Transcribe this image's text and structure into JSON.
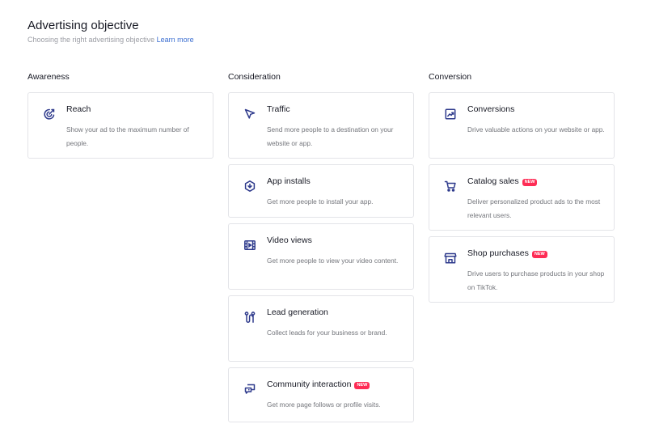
{
  "header": {
    "title": "Advertising objective",
    "subtitle": "Choosing the right advertising objective",
    "learn_more": "Learn more"
  },
  "colors": {
    "icon": "#2e3a8c",
    "badge": "#fe2c55",
    "link": "#3c6fd1"
  },
  "columns": [
    {
      "label": "Awareness",
      "items": [
        {
          "name": "Reach",
          "icon": "reach-icon",
          "description": "Show your ad to the maximum number of people."
        }
      ]
    },
    {
      "label": "Consideration",
      "items": [
        {
          "name": "Traffic",
          "icon": "cursor-icon",
          "description": "Send more people to a destination on your website or app."
        },
        {
          "name": "App installs",
          "icon": "app-install-icon",
          "description": "Get more people to install your app."
        },
        {
          "name": "Video views",
          "icon": "video-icon",
          "description": "Get more people to view your video content."
        },
        {
          "name": "Lead generation",
          "icon": "lead-icon",
          "description": "Collect leads for your business or brand."
        },
        {
          "name": "Community interaction",
          "icon": "community-icon",
          "badge": "NEW",
          "description": "Get more page follows or profile visits."
        }
      ]
    },
    {
      "label": "Conversion",
      "items": [
        {
          "name": "Conversions",
          "icon": "conversions-icon",
          "description": "Drive valuable actions on your website or app."
        },
        {
          "name": "Catalog sales",
          "icon": "cart-icon",
          "badge": "NEW",
          "description": "Deliver personalized product ads to the most relevant users."
        },
        {
          "name": "Shop purchases",
          "icon": "shop-icon",
          "badge": "NEW",
          "description": "Drive users to purchase products in your shop on TikTok."
        }
      ]
    }
  ]
}
